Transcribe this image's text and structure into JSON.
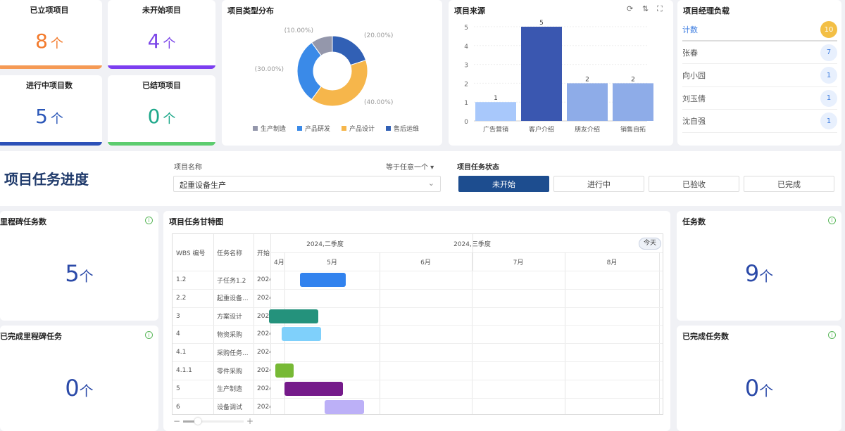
{
  "stats": [
    {
      "title": "已立项项目",
      "value": "8",
      "unit": "个",
      "color": "#f37a2b",
      "bar": "#f59a55"
    },
    {
      "title": "未开始项目",
      "value": "4",
      "unit": "个",
      "color": "#7b45e8",
      "bar": "#7c3ef0"
    },
    {
      "title": "进行中项目数",
      "value": "5",
      "unit": "个",
      "color": "#2b57b8",
      "bar": "#2b50b8"
    },
    {
      "title": "已结项项目",
      "value": "0",
      "unit": "个",
      "color": "#1ea88a",
      "bar": "#5ccc6e"
    }
  ],
  "chart_data": [
    {
      "type": "pie",
      "title": "项目类型分布",
      "labels": [
        "生产制造",
        "产品研发",
        "产品设计",
        "售后运维"
      ],
      "values": [
        10,
        30,
        40,
        20
      ],
      "value_labels": [
        "(10.00%)",
        "(30.00%)",
        "(40.00%)",
        "(20.00%)"
      ],
      "colors": [
        "#9497ab",
        "#3a8ae8",
        "#f6b64b",
        "#3160b5"
      ],
      "legend": "bottom"
    },
    {
      "type": "bar",
      "title": "项目来源",
      "categories": [
        "广告营销",
        "客户介绍",
        "朋友介绍",
        "销售自拓"
      ],
      "values": [
        1,
        5,
        2,
        2
      ],
      "colors": [
        "#a8c8fb",
        "#3a57b0",
        "#8eace8",
        "#8eace8"
      ],
      "ylim": [
        0,
        5
      ],
      "yticks": [
        "0",
        "1",
        "2",
        "3",
        "4",
        "5"
      ]
    }
  ],
  "bar_icons": [
    "refresh-icon",
    "sort-icon",
    "fullscreen-icon"
  ],
  "managers": {
    "title": "项目经理负载",
    "total_label": "计数",
    "total": "10",
    "rows": [
      {
        "name": "张春",
        "count": "7"
      },
      {
        "name": "向小园",
        "count": "1"
      },
      {
        "name": "刘玉倩",
        "count": "1"
      },
      {
        "name": "沈自强",
        "count": "1"
      }
    ]
  },
  "filter": {
    "heading": "项目任务进度",
    "project_label": "项目名称",
    "operator": "等于任意一个 ▾",
    "project_value": "起重设备生产",
    "status_label": "项目任务状态",
    "statuses": [
      "未开始",
      "进行中",
      "已验收",
      "已完成"
    ],
    "active_status": "未开始"
  },
  "milestones": {
    "title": "里程碑任务数",
    "value": "5",
    "unit": "个"
  },
  "done_milestones": {
    "title": "已完成里程碑任务",
    "value": "0",
    "unit": "个"
  },
  "tasks": {
    "title": "任务数",
    "value": "9",
    "unit": "个"
  },
  "done_tasks": {
    "title": "已完成任务数",
    "value": "0",
    "unit": "个"
  },
  "gantt": {
    "title": "项目任务甘特图",
    "today": "今天",
    "cols": [
      "WBS 编号",
      "任务名称",
      "开始"
    ],
    "quarters": [
      "2024,二季度",
      "2024,三季度"
    ],
    "months": [
      "4月",
      "5月",
      "6月",
      "7月",
      "8月"
    ],
    "rows": [
      {
        "wbs": "1.2",
        "name": "子任务1.2",
        "start": "2024",
        "bar_start": "2024-05-06",
        "bar_end": "2024-05-21",
        "color": "#3182ee"
      },
      {
        "wbs": "2.2",
        "name": "起重设备...",
        "start": "2024"
      },
      {
        "wbs": "3",
        "name": "方案设计",
        "start": "2024",
        "bar_start": "2024-04-26",
        "bar_end": "2024-05-12",
        "color": "#24927c"
      },
      {
        "wbs": "4",
        "name": "物资采购",
        "start": "2024",
        "bar_start": "2024-04-30",
        "bar_end": "2024-05-13",
        "color": "#7fd0fb"
      },
      {
        "wbs": "4.1",
        "name": "采购任务...",
        "start": "2024"
      },
      {
        "wbs": "4.1.1",
        "name": "零件采购",
        "start": "2024",
        "bar_start": "2024-04-28",
        "bar_end": "2024-05-04",
        "color": "#77b935"
      },
      {
        "wbs": "5",
        "name": "生产制造",
        "start": "2024",
        "bar_start": "2024-05-01",
        "bar_end": "2024-05-20",
        "color": "#751a8a"
      },
      {
        "wbs": "6",
        "name": "设备调试",
        "start": "2024",
        "bar_start": "2024-05-14",
        "bar_end": "2024-05-27",
        "color": "#bcb0f7"
      }
    ]
  }
}
